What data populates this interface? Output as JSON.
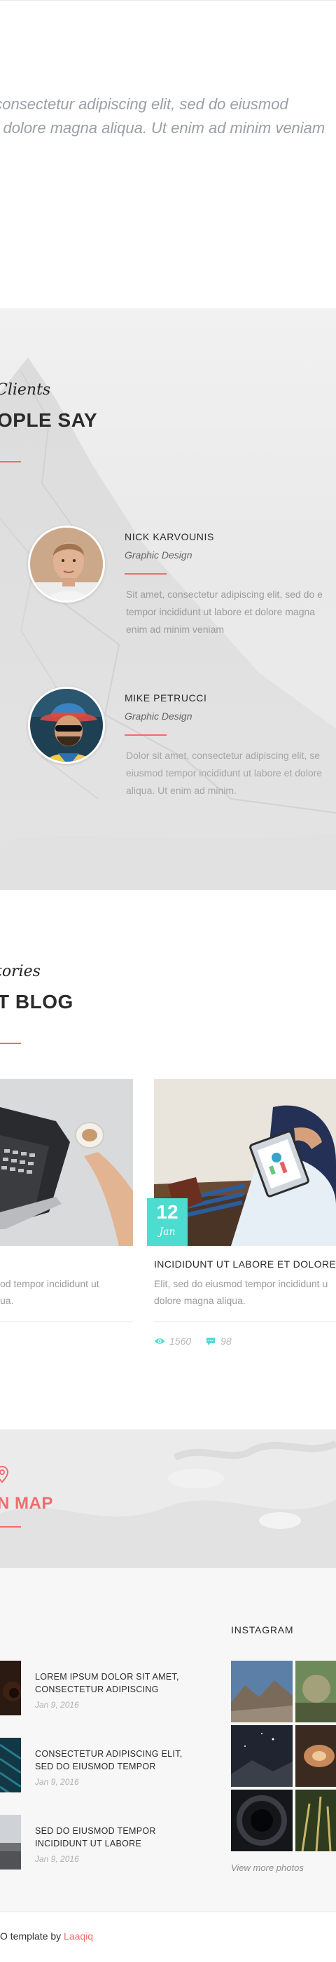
{
  "intro": {
    "line1": ", consectetur adipiscing elit, sed do eiusmod",
    "line2": "et dolore magna aliqua. Ut enim ad minim veniam"
  },
  "testimonials": {
    "script_title": "Clients",
    "title": "OPLE SAY",
    "items": [
      {
        "name": "NICK KARVOUNIS",
        "role": "Graphic Design",
        "lines": [
          "Sit amet, consectetur adipiscing elit, sed do e",
          "tempor incididunt ut labore et dolore magna",
          "enim ad minim veniam"
        ]
      },
      {
        "name": "MIKE PETRUCCI",
        "role": "Graphic Design",
        "lines": [
          "Dolor sit amet, consectetur adipiscing elit, se",
          "eiusmod tempor incididunt ut labore et dolore",
          "aliqua. Ut enim ad minim."
        ]
      }
    ]
  },
  "blog": {
    "script_title": "tories",
    "title": "T BLOG",
    "post_left": {
      "text_line1": "od tempor incididunt ut",
      "text_line2": "ua."
    },
    "post_right": {
      "day": "12",
      "month": "Jan",
      "title": "INCIDIDUNT UT LABORE ET DOLORE",
      "text_line1": "Elit, sed do eiusmod tempor incididunt u",
      "text_line2": "dolore magna aliqua.",
      "views": "1560",
      "comments": "98"
    }
  },
  "map": {
    "title": "N MAP",
    "icon": "location-pin-icon"
  },
  "footer": {
    "posts": [
      {
        "title_line1": "LOREM IPSUM DOLOR SIT AMET,",
        "title_line2": "CONSECTETUR ADIPISCING",
        "date": "Jan 9, 2016"
      },
      {
        "title_line1": "CONSECTETUR ADIPISCING ELIT,",
        "title_line2": "SED DO EIUSMOD TEMPOR",
        "date": "Jan 9, 2016"
      },
      {
        "title_line1": "SED DO EIUSMOD TEMPOR",
        "title_line2": "INCIDIDUNT UT LABORE",
        "date": "Jan 9, 2016"
      }
    ],
    "instagram_title": "INSTAGRAM",
    "view_more": "View more photos"
  },
  "copyright": {
    "text": "O template by ",
    "link": "Laaqiq"
  },
  "colors": {
    "accent": "#f06c6c",
    "teal": "#4ddcd0"
  }
}
